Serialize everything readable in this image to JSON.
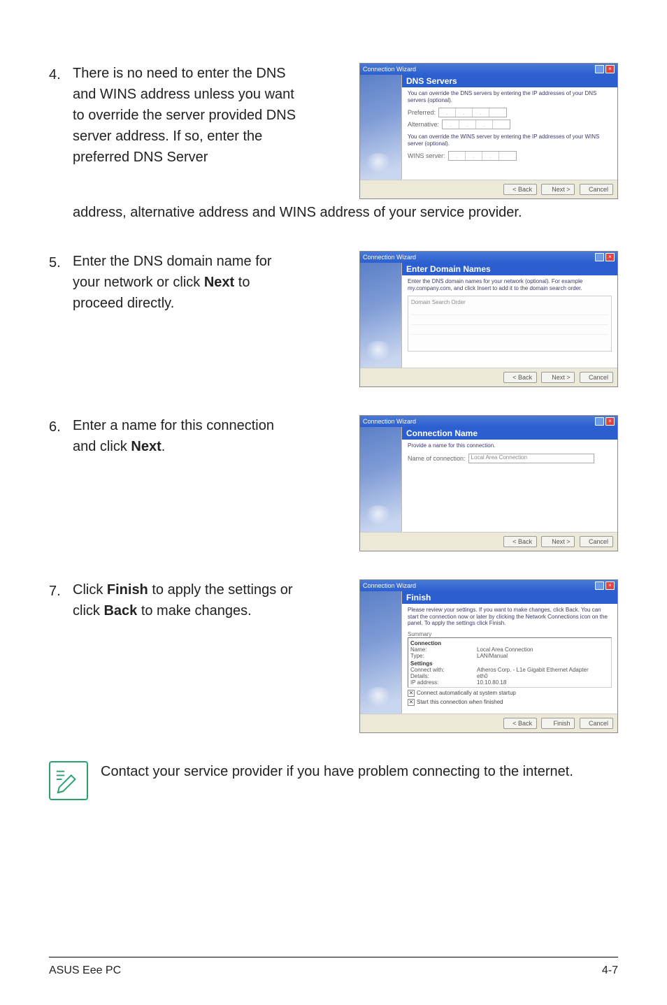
{
  "steps": {
    "s4": {
      "num": "4.",
      "text_a": "There is no need to enter the DNS and WINS address unless you want to override the server provided DNS server address. If so, enter the preferred DNS Server",
      "text_b": "address, alternative address and WINS address of your service provider."
    },
    "s5": {
      "num": "5.",
      "text_a_pre": "Enter the DNS domain name for your network or click ",
      "text_a_bold": "Next",
      "text_a_post": " to proceed directly."
    },
    "s6": {
      "num": "6.",
      "text_a_pre": "Enter a name for this connection and click ",
      "text_a_bold": "Next",
      "text_a_post": "."
    },
    "s7": {
      "num": "7.",
      "text_a_pre": "Click ",
      "text_a_bold1": "Finish",
      "text_a_mid": " to apply the settings or click ",
      "text_a_bold2": "Back",
      "text_a_post": " to make changes."
    }
  },
  "wizard": {
    "title": "Connection Wizard",
    "back": "< Back",
    "next": "Next >",
    "cancel": "Cancel",
    "finish": "Finish",
    "dns": {
      "banner": "DNS Servers",
      "desc1": "You can override the DNS servers by entering the IP addresses of your DNS servers (optional).",
      "preferred": "Preferred:",
      "alternative": "Alternative:",
      "desc2": "You can override the WINS server by entering the IP addresses of your WINS server (optional).",
      "wins": "WINS server:"
    },
    "domain": {
      "banner": "Enter Domain Names",
      "desc": "Enter the DNS domain names for your network (optional). For example my.company.com, and click Insert to add it to the domain search order.",
      "fs_label": "Domain Search Order"
    },
    "conn": {
      "banner": "Connection Name",
      "desc": "Provide a name for this connection.",
      "label": "Name of connection:",
      "value": "Local Area Connection"
    },
    "fin": {
      "banner": "Finish",
      "desc": "Please review your settings. If you want to make changes, click Back. You can start the connection now or later by clicking the Network Connections icon on the panel. To apply the settings click Finish.",
      "summary_label": "Summary",
      "conn_hdr": "Connection",
      "name_lbl": "Name:",
      "name_val": "Local Area Connection",
      "type_lbl": "Type:",
      "type_val": "LAN/Manual",
      "set_hdr": "Settings",
      "cw_lbl": "Connect with:",
      "cw_val": "Atheros Corp. - L1e Gigabit Ethernet Adapter",
      "det_lbl": "Details:",
      "det_val": "eth0",
      "ip_lbl": "IP address:",
      "ip_val": "10.10.80.18",
      "chk1": "Connect automatically at system startup",
      "chk2": "Start this connection when finished"
    }
  },
  "note": "Contact your service provider if you have problem connecting to the internet.",
  "footer": {
    "left": "ASUS Eee PC",
    "right": "4-7"
  }
}
